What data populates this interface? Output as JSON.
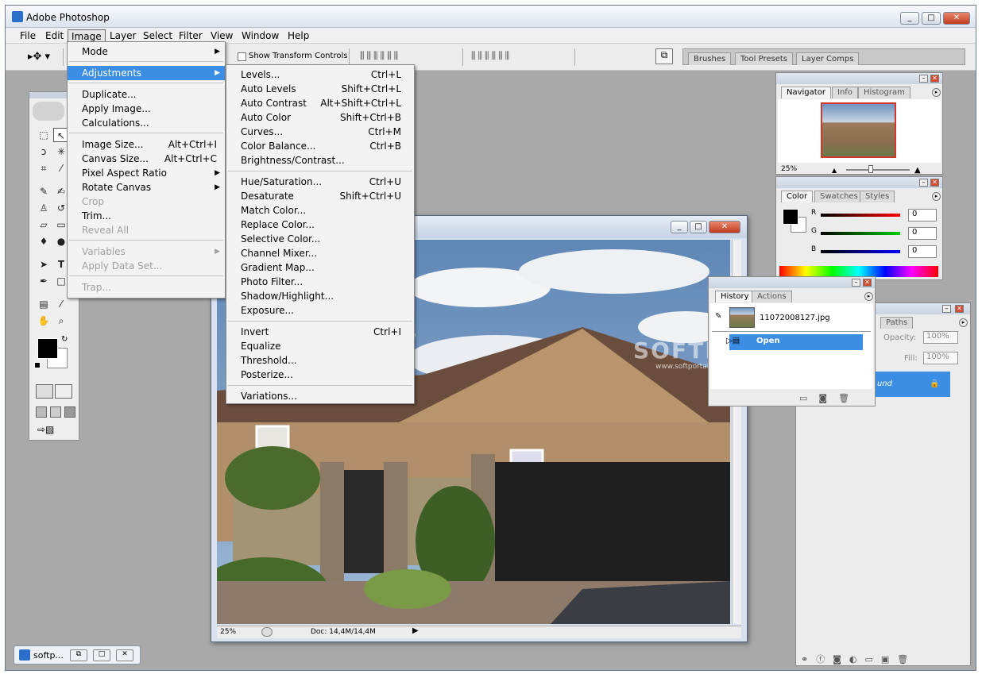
{
  "app": {
    "title": "Adobe Photoshop"
  },
  "menubar": [
    "File",
    "Edit",
    "Image",
    "Layer",
    "Select",
    "Filter",
    "View",
    "Window",
    "Help"
  ],
  "optionsbar": {
    "checkbox_label": "Show Transform Controls"
  },
  "wells": [
    "Brushes",
    "Tool Presets",
    "Layer Comps"
  ],
  "image_menu": {
    "items": [
      {
        "label": "Mode",
        "sub": true
      },
      {
        "label": "Adjustments",
        "sub": true,
        "highlight": true
      },
      {
        "label": "Duplicate..."
      },
      {
        "label": "Apply Image..."
      },
      {
        "label": "Calculations..."
      },
      {
        "label": "Image Size...",
        "shortcut": "Alt+Ctrl+I"
      },
      {
        "label": "Canvas Size...",
        "shortcut": "Alt+Ctrl+C"
      },
      {
        "label": "Pixel Aspect Ratio",
        "sub": true
      },
      {
        "label": "Rotate Canvas",
        "sub": true
      },
      {
        "label": "Crop",
        "disabled": true
      },
      {
        "label": "Trim..."
      },
      {
        "label": "Reveal All",
        "disabled": true
      },
      {
        "label": "Variables",
        "sub": true,
        "disabled": true
      },
      {
        "label": "Apply Data Set...",
        "disabled": true
      },
      {
        "label": "Trap...",
        "disabled": true
      }
    ]
  },
  "adjustments_menu": {
    "items": [
      {
        "label": "Levels...",
        "shortcut": "Ctrl+L"
      },
      {
        "label": "Auto Levels",
        "shortcut": "Shift+Ctrl+L"
      },
      {
        "label": "Auto Contrast",
        "shortcut": "Alt+Shift+Ctrl+L"
      },
      {
        "label": "Auto Color",
        "shortcut": "Shift+Ctrl+B"
      },
      {
        "label": "Curves...",
        "shortcut": "Ctrl+M"
      },
      {
        "label": "Color Balance...",
        "shortcut": "Ctrl+B"
      },
      {
        "label": "Brightness/Contrast..."
      },
      {
        "label": "Hue/Saturation...",
        "shortcut": "Ctrl+U"
      },
      {
        "label": "Desaturate",
        "shortcut": "Shift+Ctrl+U"
      },
      {
        "label": "Match Color..."
      },
      {
        "label": "Replace Color..."
      },
      {
        "label": "Selective Color..."
      },
      {
        "label": "Channel Mixer..."
      },
      {
        "label": "Gradient Map..."
      },
      {
        "label": "Photo Filter..."
      },
      {
        "label": "Shadow/Highlight..."
      },
      {
        "label": "Exposure..."
      },
      {
        "label": "Invert",
        "shortcut": "Ctrl+I"
      },
      {
        "label": "Equalize"
      },
      {
        "label": "Threshold..."
      },
      {
        "label": "Posterize..."
      },
      {
        "label": "Variations..."
      }
    ]
  },
  "navigator": {
    "tabs": [
      "Navigator",
      "Info",
      "Histogram"
    ],
    "zoom": "25%"
  },
  "color": {
    "tabs": [
      "Color",
      "Swatches",
      "Styles"
    ],
    "channels": [
      {
        "label": "R",
        "value": "0"
      },
      {
        "label": "G",
        "value": "0"
      },
      {
        "label": "B",
        "value": "0"
      }
    ]
  },
  "history": {
    "tabs": [
      "History",
      "Actions"
    ],
    "snapshot": "11072008127.jpg",
    "state": "Open"
  },
  "layers": {
    "tabs": [
      "Paths"
    ],
    "opacity_label": "Opacity:",
    "opacity": "100%",
    "fill_label": "Fill:",
    "fill": "100%",
    "layer_fragment": "und"
  },
  "image_window": {
    "zoom": "25%",
    "doc": "Doc: 14,4M/14,4M"
  },
  "watermark": {
    "text": "SOFTPORTAL",
    "url": "www.softportal.com"
  },
  "taskbar": {
    "label": "softp..."
  }
}
